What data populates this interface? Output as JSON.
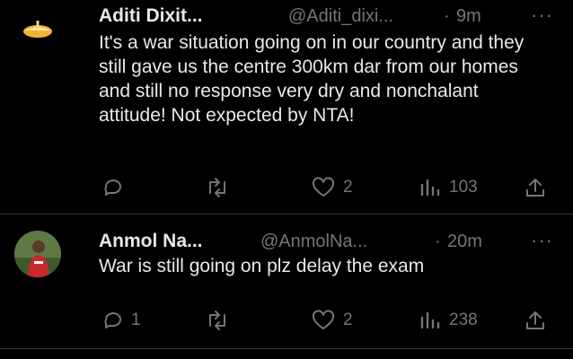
{
  "tweets": [
    {
      "name": "Aditi Dixit...",
      "handle": "@Aditi_dixi...",
      "dot": "·",
      "time": "9m",
      "more": "···",
      "text": "It's a war situation going on in our country and they still gave us the centre 300km dar from our homes and still no response very dry and nonchalant attitude! Not expected by NTA!",
      "reply_count": "",
      "like_count": "2",
      "view_count": "103"
    },
    {
      "name": "Anmol Na...",
      "handle": "@AnmolNa...",
      "dot": "·",
      "time": "20m",
      "more": "···",
      "text": "War is still going on plz delay the exam",
      "reply_count": "1",
      "like_count": "2",
      "view_count": "238"
    }
  ],
  "colors": {
    "background": "#000000",
    "text": "#e7e9ea",
    "muted": "#71767b",
    "divider": "#2f3336"
  }
}
